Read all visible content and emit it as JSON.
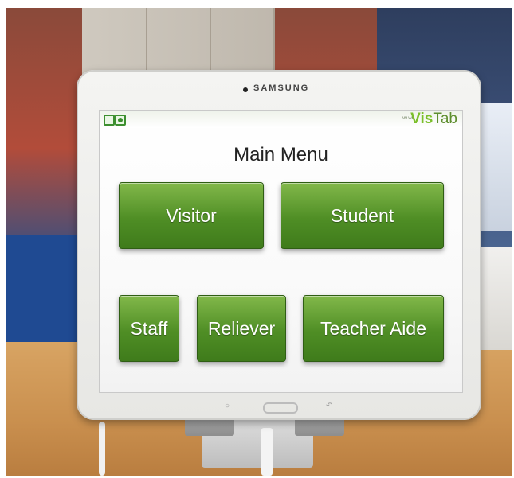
{
  "device": {
    "brand": "SAMSUNG"
  },
  "app": {
    "logo_small": "vv.wl",
    "logo_vis": "Vis",
    "logo_tab": "Tab",
    "accent_color": "#4f8e25"
  },
  "screen": {
    "title": "Main Menu",
    "buttons": {
      "visitor": "Visitor",
      "student": "Student",
      "staff": "Staff",
      "reliever": "Reliever",
      "teacher_aide": "Teacher Aide"
    }
  },
  "icons": {
    "status_left": "status-square-icon",
    "status_right": "status-indicator-icon"
  }
}
